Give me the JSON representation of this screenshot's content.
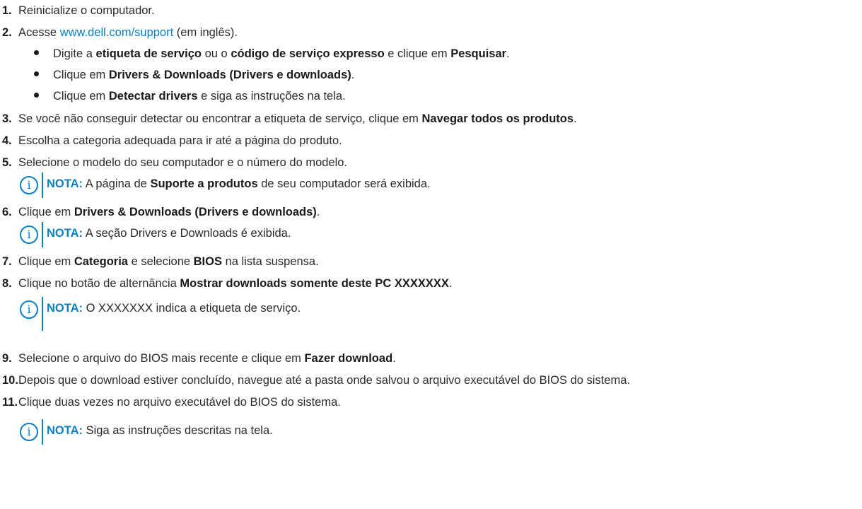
{
  "steps": [
    {
      "n": "1.",
      "parts": [
        {
          "t": "Reinicialize o computador."
        }
      ]
    },
    {
      "n": "2.",
      "parts": [
        {
          "t": "Acesse "
        },
        {
          "t": "www.dell.com/support",
          "link": true
        },
        {
          "t": " (em inglês)."
        }
      ]
    },
    {
      "n": "3.",
      "parts": [
        {
          "t": "Se você não conseguir detectar ou encontrar a etiqueta de serviço, clique em "
        },
        {
          "t": "Navegar todos os produtos",
          "b": true
        },
        {
          "t": "."
        }
      ]
    },
    {
      "n": "4.",
      "parts": [
        {
          "t": "Escolha a categoria adequada para ir até a página do produto."
        }
      ]
    },
    {
      "n": "5.",
      "parts": [
        {
          "t": "Selecione o modelo do seu computador e o número do modelo."
        }
      ]
    },
    {
      "n": "6.",
      "parts": [
        {
          "t": "Clique em "
        },
        {
          "t": "Drivers & Downloads (Drivers e downloads)",
          "b": true
        },
        {
          "t": "."
        }
      ]
    },
    {
      "n": "7.",
      "parts": [
        {
          "t": "Clique em "
        },
        {
          "t": "Categoria",
          "b": true
        },
        {
          "t": " e selecione "
        },
        {
          "t": "BIOS",
          "b": true
        },
        {
          "t": " na lista suspensa."
        }
      ]
    },
    {
      "n": "8.",
      "parts": [
        {
          "t": "Clique no botão de alternância "
        },
        {
          "t": "Mostrar downloads somente deste PC XXXXXXX",
          "b": true
        },
        {
          "t": "."
        }
      ]
    },
    {
      "n": "9.",
      "parts": [
        {
          "t": "Selecione o arquivo do BIOS mais recente e clique em "
        },
        {
          "t": "Fazer download",
          "b": true
        },
        {
          "t": "."
        }
      ]
    },
    {
      "n": "10.",
      "parts": [
        {
          "t": "Depois que o download estiver concluído, navegue até a pasta onde salvou o arquivo executável do BIOS do sistema."
        }
      ]
    },
    {
      "n": "11.",
      "parts": [
        {
          "t": "Clique duas vezes no arquivo executável do BIOS do sistema."
        }
      ]
    }
  ],
  "bullets": [
    {
      "parts": [
        {
          "t": "Digite a "
        },
        {
          "t": "etiqueta de serviço",
          "b": true
        },
        {
          "t": " ou o "
        },
        {
          "t": "código de serviço expresso",
          "b": true
        },
        {
          "t": " e clique em "
        },
        {
          "t": "Pesquisar",
          "b": true
        },
        {
          "t": "."
        }
      ]
    },
    {
      "parts": [
        {
          "t": "Clique em "
        },
        {
          "t": "Drivers & Downloads (Drivers e downloads)",
          "b": true
        },
        {
          "t": "."
        }
      ]
    },
    {
      "parts": [
        {
          "t": "Clique em "
        },
        {
          "t": "Detectar drivers",
          "b": true
        },
        {
          "t": " e siga as instruções na tela."
        }
      ]
    }
  ],
  "notes": [
    {
      "label": "NOTA:",
      "parts": [
        {
          "t": " A página de "
        },
        {
          "t": "Suporte a produtos",
          "b": true
        },
        {
          "t": " de seu computador será exibida."
        }
      ]
    },
    {
      "label": "NOTA:",
      "parts": [
        {
          "t": " A seção Drivers e Downloads é exibida."
        }
      ]
    },
    {
      "label": "NOTA:",
      "parts": [
        {
          "t": " O XXXXXXX indica a etiqueta de serviço."
        }
      ]
    },
    {
      "label": "NOTA:",
      "parts": [
        {
          "t": " Siga as instruções descritas na tela."
        }
      ]
    }
  ],
  "icons": {
    "note": "info-icon"
  },
  "colors": {
    "accent": "#0a7fc3",
    "text": "#2b2b2b"
  }
}
